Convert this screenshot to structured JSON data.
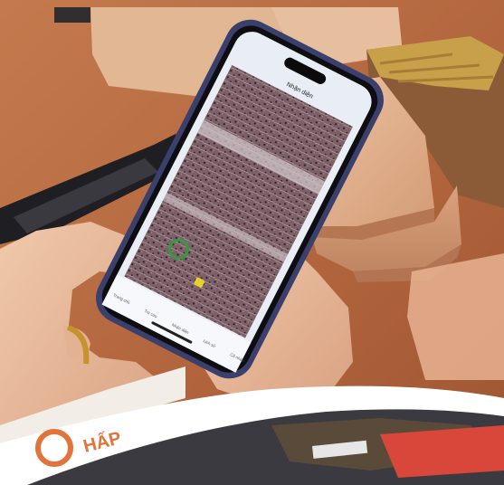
{
  "phone_screen": {
    "title": "Nhận diện",
    "nav_items": [
      {
        "label": "Trang chủ"
      },
      {
        "label": "Tra cứu"
      },
      {
        "label": "Nhận diện"
      },
      {
        "label": "Lịch sử"
      },
      {
        "label": "Cá nhân"
      }
    ]
  },
  "magazine": {
    "cover_text": "HẤP"
  },
  "colors": {
    "table": "#b86a44",
    "wood_block": "#e0b08c",
    "phone_frame": "#3a3f6b",
    "screen_bg": "#e8eef4",
    "marker_green": "#2e9d3a",
    "marker_yellow": "#e8d02a"
  }
}
